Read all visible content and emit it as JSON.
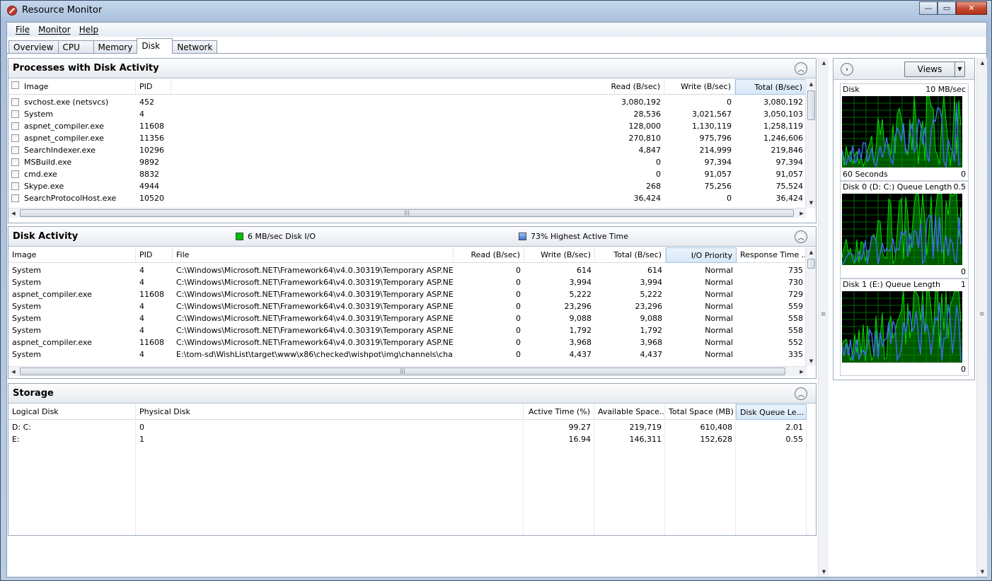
{
  "window": {
    "title": "Resource Monitor",
    "buttons": [
      "—",
      "▭",
      "✕"
    ]
  },
  "menu": [
    "File",
    "Monitor",
    "Help"
  ],
  "tabs": [
    "Overview",
    "CPU",
    "Memory",
    "Disk",
    "Network"
  ],
  "processes": {
    "title": "Processes with Disk Activity",
    "headers": {
      "image": "Image",
      "pid": "PID",
      "read": "Read (B/sec)",
      "write": "Write (B/sec)",
      "total": "Total (B/sec)"
    },
    "rows": [
      {
        "image": "svchost.exe (netsvcs)",
        "pid": "452",
        "read": "3,080,192",
        "write": "0",
        "total": "3,080,192"
      },
      {
        "image": "System",
        "pid": "4",
        "read": "28,536",
        "write": "3,021,567",
        "total": "3,050,103"
      },
      {
        "image": "aspnet_compiler.exe",
        "pid": "11608",
        "read": "128,000",
        "write": "1,130,119",
        "total": "1,258,119"
      },
      {
        "image": "aspnet_compiler.exe",
        "pid": "11356",
        "read": "270,810",
        "write": "975,796",
        "total": "1,246,606"
      },
      {
        "image": "SearchIndexer.exe",
        "pid": "10296",
        "read": "4,847",
        "write": "214,999",
        "total": "219,846"
      },
      {
        "image": "MSBuild.exe",
        "pid": "9892",
        "read": "0",
        "write": "97,394",
        "total": "97,394"
      },
      {
        "image": "cmd.exe",
        "pid": "8832",
        "read": "0",
        "write": "91,057",
        "total": "91,057"
      },
      {
        "image": "Skype.exe",
        "pid": "4944",
        "read": "268",
        "write": "75,256",
        "total": "75,524"
      },
      {
        "image": "SearchProtocolHost.exe",
        "pid": "10520",
        "read": "36,424",
        "write": "0",
        "total": "36,424"
      }
    ]
  },
  "disk_activity": {
    "title": "Disk Activity",
    "legend_io": "6 MB/sec Disk I/O",
    "legend_active": "73% Highest Active Time",
    "headers": {
      "image": "Image",
      "pid": "PID",
      "file": "File",
      "read": "Read (B/sec)",
      "write": "Write (B/sec)",
      "total": "Total (B/sec)",
      "priority": "I/O Priority",
      "response": "Response Time ..."
    },
    "rows": [
      {
        "image": "System",
        "pid": "4",
        "file": "C:\\Windows\\Microsoft.NET\\Framework64\\v4.0.30319\\Temporary ASP.NET ...",
        "read": "0",
        "write": "614",
        "total": "614",
        "priority": "Normal",
        "response": "735"
      },
      {
        "image": "System",
        "pid": "4",
        "file": "C:\\Windows\\Microsoft.NET\\Framework64\\v4.0.30319\\Temporary ASP.NET ...",
        "read": "0",
        "write": "3,994",
        "total": "3,994",
        "priority": "Normal",
        "response": "730"
      },
      {
        "image": "aspnet_compiler.exe",
        "pid": "11608",
        "file": "C:\\Windows\\Microsoft.NET\\Framework64\\v4.0.30319\\Temporary ASP.NET ...",
        "read": "0",
        "write": "5,222",
        "total": "5,222",
        "priority": "Normal",
        "response": "729"
      },
      {
        "image": "System",
        "pid": "4",
        "file": "C:\\Windows\\Microsoft.NET\\Framework64\\v4.0.30319\\Temporary ASP.NET ...",
        "read": "0",
        "write": "23,296",
        "total": "23,296",
        "priority": "Normal",
        "response": "559"
      },
      {
        "image": "System",
        "pid": "4",
        "file": "C:\\Windows\\Microsoft.NET\\Framework64\\v4.0.30319\\Temporary ASP.NET ...",
        "read": "0",
        "write": "9,088",
        "total": "9,088",
        "priority": "Normal",
        "response": "558"
      },
      {
        "image": "System",
        "pid": "4",
        "file": "C:\\Windows\\Microsoft.NET\\Framework64\\v4.0.30319\\Temporary ASP.NET ...",
        "read": "0",
        "write": "1,792",
        "total": "1,792",
        "priority": "Normal",
        "response": "558"
      },
      {
        "image": "aspnet_compiler.exe",
        "pid": "11608",
        "file": "C:\\Windows\\Microsoft.NET\\Framework64\\v4.0.30319\\Temporary ASP.NET ...",
        "read": "0",
        "write": "3,968",
        "total": "3,968",
        "priority": "Normal",
        "response": "552"
      },
      {
        "image": "System",
        "pid": "4",
        "file": "E:\\tom-sd\\WishList\\target\\www\\x86\\checked\\wishpot\\img\\channels\\cha...",
        "read": "0",
        "write": "4,437",
        "total": "4,437",
        "priority": "Normal",
        "response": "335"
      }
    ]
  },
  "storage": {
    "title": "Storage",
    "headers": {
      "logical": "Logical Disk",
      "physical": "Physical Disk",
      "active": "Active Time (%)",
      "avail": "Available Space...",
      "total": "Total Space (MB)",
      "queue": "Disk Queue Le..."
    },
    "rows": [
      {
        "logical": "D: C:",
        "physical": "0",
        "active": "99.27",
        "avail": "219,719",
        "total": "610,408",
        "queue": "2.01"
      },
      {
        "logical": "E:",
        "physical": "1",
        "active": "16.94",
        "avail": "146,311",
        "total": "152,628",
        "queue": "0.55"
      }
    ]
  },
  "graphs_pane": {
    "views_label": "Views",
    "graphs": [
      {
        "label": "Disk",
        "max": "10 MB/sec",
        "bottom_left": "60 Seconds",
        "min": "0"
      },
      {
        "label": "Disk 0 (D: C:) Queue Length",
        "max": "0.5",
        "bottom_left": "",
        "min": "0"
      },
      {
        "label": "Disk 1 (E:) Queue Length",
        "max": "1",
        "bottom_left": "",
        "min": "0"
      }
    ]
  },
  "colors": {
    "io_legend": "#00c000",
    "active_legend": "#3b6fd8",
    "graph_bg": "#000000",
    "graph_grid": "#006400",
    "graph_green": "#00e000",
    "graph_blue": "#3d6be8"
  }
}
